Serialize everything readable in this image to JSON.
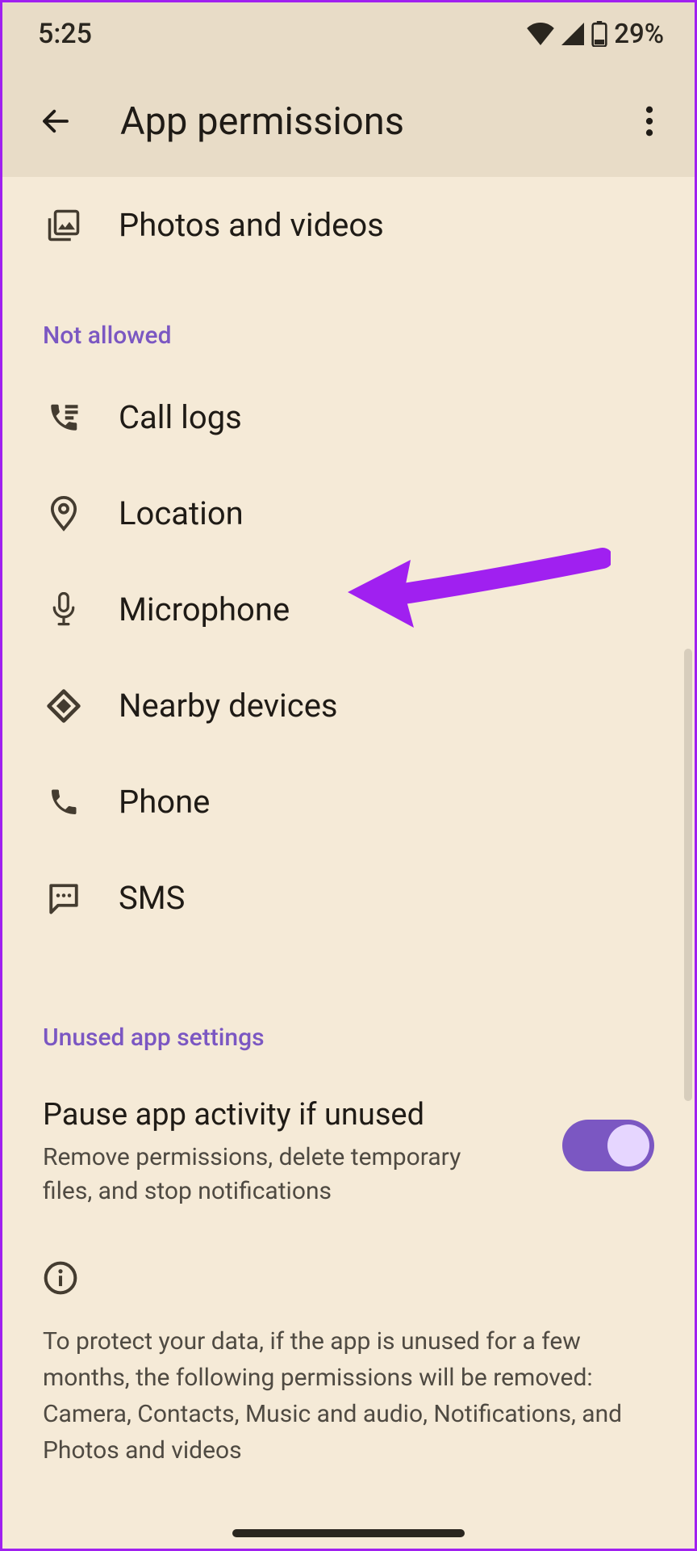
{
  "status": {
    "time": "5:25",
    "battery_pct": "29%"
  },
  "header": {
    "title": "App permissions"
  },
  "permissions_allowed_visible": [
    {
      "id": "photos",
      "label": "Photos and videos"
    }
  ],
  "section_not_allowed": "Not allowed",
  "permissions_not_allowed": [
    {
      "id": "call-logs",
      "label": "Call logs"
    },
    {
      "id": "location",
      "label": "Location"
    },
    {
      "id": "microphone",
      "label": "Microphone"
    },
    {
      "id": "nearby",
      "label": "Nearby devices"
    },
    {
      "id": "phone",
      "label": "Phone"
    },
    {
      "id": "sms",
      "label": "SMS"
    }
  ],
  "section_unused": "Unused app settings",
  "pause": {
    "title": "Pause app activity if unused",
    "subtitle": "Remove permissions, delete temporary files, and stop notifications",
    "enabled": true
  },
  "info_text": "To protect your data, if the app is unused for a few months, the following permissions will be removed: Camera, Contacts, Music and audio, Notifications, and Photos and videos"
}
